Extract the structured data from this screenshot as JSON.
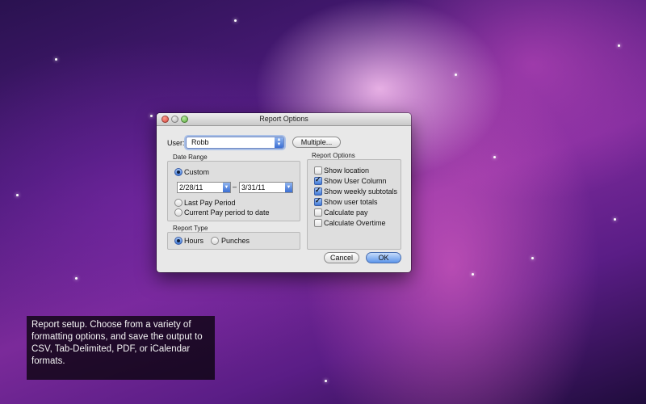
{
  "dialog": {
    "title": "Report Options",
    "user_label": "User:",
    "user_value": "Robb",
    "multiple_button": "Multiple...",
    "date_range": {
      "title": "Date Range",
      "custom_label": "Custom",
      "start_date": "2/28/11",
      "date_separator": "–",
      "end_date": "3/31/11",
      "last_pay_period": "Last Pay Period",
      "current_pay_period": "Current Pay period to date",
      "selected": "Custom"
    },
    "report_type": {
      "title": "Report Type",
      "hours_label": "Hours",
      "punches_label": "Punches",
      "selected": "Hours"
    },
    "report_options": {
      "title": "Report Options",
      "items": [
        {
          "label": "Show location",
          "checked": false
        },
        {
          "label": "Show User Column",
          "checked": true
        },
        {
          "label": "Show weekly subtotals",
          "checked": true
        },
        {
          "label": "Show user totals",
          "checked": true
        },
        {
          "label": "Calculate pay",
          "checked": false
        },
        {
          "label": "Calculate Overtime",
          "checked": false
        }
      ]
    },
    "cancel_button": "Cancel",
    "ok_button": "OK"
  },
  "caption": {
    "text": "Report setup. Choose from a variety of formatting options, and save the output to CSV, Tab-Delimited, PDF, or iCalendar formats."
  }
}
